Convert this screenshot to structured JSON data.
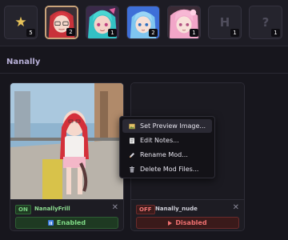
{
  "slots": [
    {
      "type": "star",
      "count": "5"
    },
    {
      "type": "portrait-red",
      "count": "2"
    },
    {
      "type": "portrait-teal",
      "count": "1"
    },
    {
      "type": "portrait-blue",
      "count": "2"
    },
    {
      "type": "portrait-pink",
      "count": "1"
    },
    {
      "type": "letter",
      "letter": "H",
      "count": "1"
    },
    {
      "type": "letter",
      "letter": "?",
      "count": "1"
    }
  ],
  "section": {
    "title": "Nanally"
  },
  "mods": [
    {
      "status": "ON",
      "name": "NanallyFrill",
      "button": "Enabled"
    },
    {
      "status": "OFF",
      "name": "Nanally_nude",
      "button": "Disabled"
    }
  ],
  "context_menu": {
    "items": [
      {
        "label": "Set Preview Image...",
        "icon": "image-icon"
      },
      {
        "label": "Edit Notes...",
        "icon": "notes-icon"
      },
      {
        "label": "Rename Mod...",
        "icon": "pencil-icon"
      },
      {
        "label": "Delete Mod Files...",
        "icon": "trash-icon"
      }
    ]
  },
  "colors": {
    "background": "#17161d",
    "accent": "#b8b0d8",
    "enabled": "#7fd986",
    "disabled": "#ef7070",
    "selected_border": "#c9a37a"
  }
}
